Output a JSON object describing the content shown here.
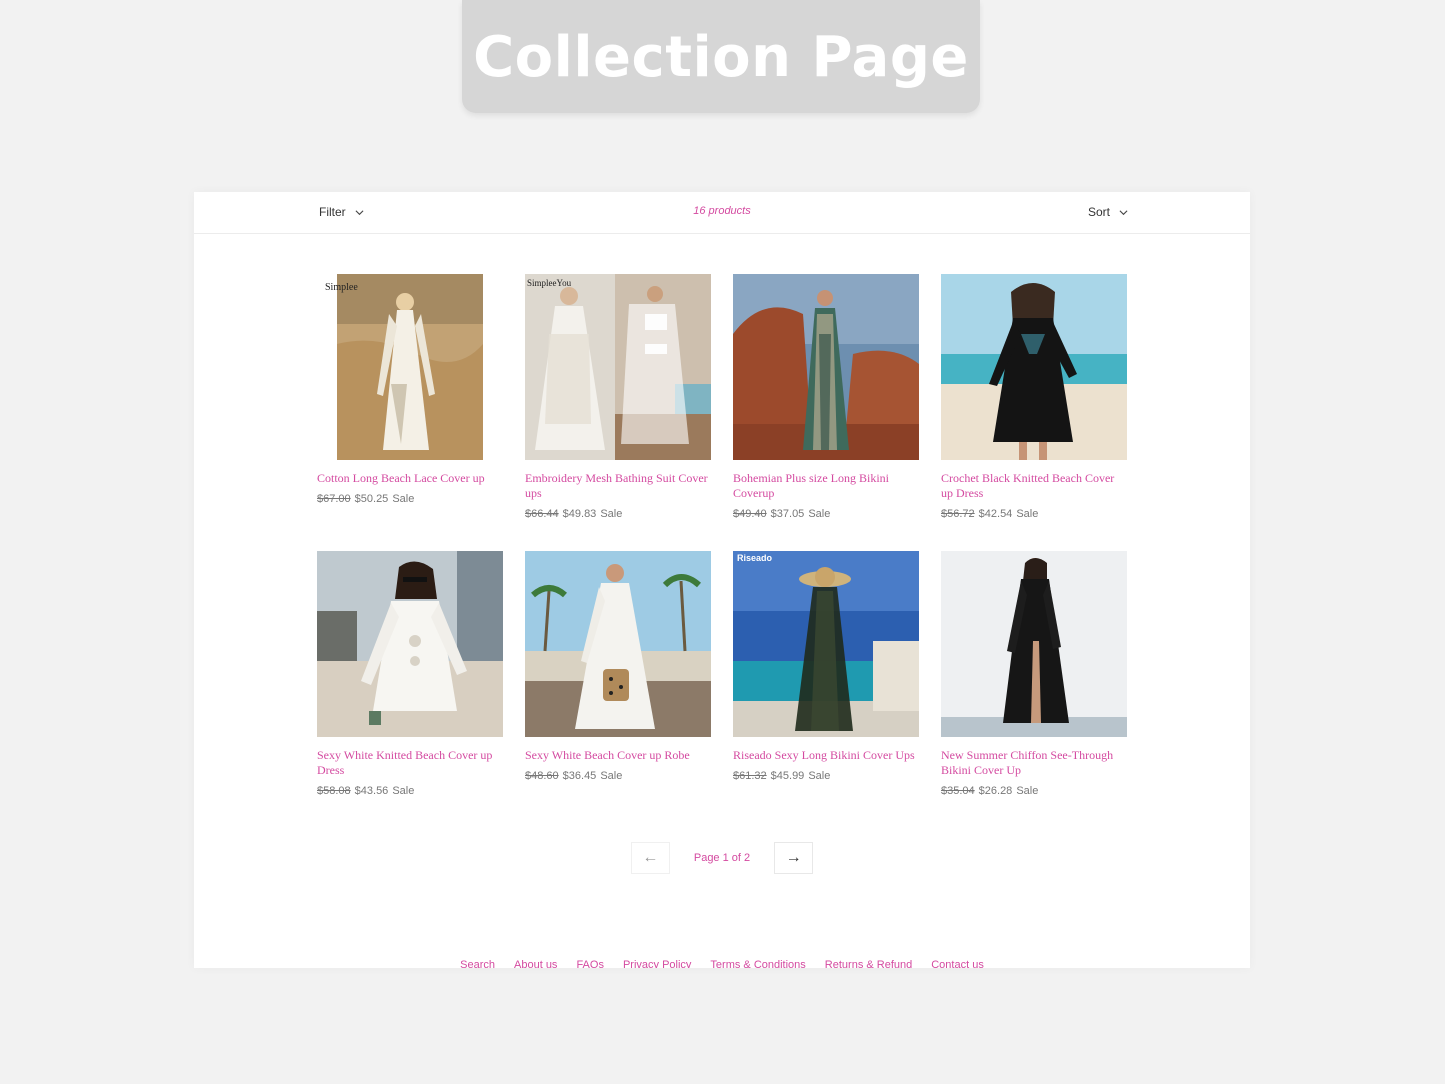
{
  "banner": {
    "title": "Collection Page"
  },
  "toolbar": {
    "filter_label": "Filter",
    "product_count": "16 products",
    "sort_label": "Sort"
  },
  "products": [
    {
      "name": "Cotton Long Beach Lace Cover up",
      "old_price": "$67.00",
      "price": "$50.25",
      "badge": "Sale",
      "image": "white-lace-long-cover-desert"
    },
    {
      "name": "Embroidery Mesh Bathing Suit Cover ups",
      "old_price": "$66.44",
      "price": "$49.83",
      "badge": "Sale",
      "image": "white-embroidery-mesh-robe"
    },
    {
      "name": "Bohemian Plus size Long Bikini Coverup",
      "old_price": "$49.40",
      "price": "$37.05",
      "badge": "Sale",
      "image": "bohemian-print-long-dress-red-rock"
    },
    {
      "name": "Crochet Black Knitted Beach Cover up Dress",
      "old_price": "$56.72",
      "price": "$42.54",
      "badge": "Sale",
      "image": "black-crochet-dress-beach"
    },
    {
      "name": "Sexy White Knitted Beach Cover up Dress",
      "old_price": "$58.08",
      "price": "$43.56",
      "badge": "Sale",
      "image": "white-knitted-tunic-beach"
    },
    {
      "name": "Sexy White Beach Cover up Robe",
      "old_price": "$48.60",
      "price": "$36.45",
      "badge": "Sale",
      "image": "white-robe-palm-trees"
    },
    {
      "name": "Riseado Sexy Long Bikini Cover Ups",
      "old_price": "$61.32",
      "price": "$45.99",
      "badge": "Sale",
      "image": "black-sheer-long-cover-sea"
    },
    {
      "name": "New Summer Chiffon See-Through Bikini Cover Up",
      "old_price": "$35.04",
      "price": "$26.28",
      "badge": "Sale",
      "image": "black-chiffon-long-dress-studio"
    }
  ],
  "pagination": {
    "prev": "←",
    "label": "Page 1 of 2",
    "next": "→"
  },
  "footer": {
    "links": [
      "Search",
      "About us",
      "FAQs",
      "Privacy Policy",
      "Terms & Conditions",
      "Returns & Refund",
      "Contact us"
    ]
  },
  "colors": {
    "accent": "#d44aa0",
    "background": "#f2f2f2",
    "banner": "#d6d6d6"
  }
}
